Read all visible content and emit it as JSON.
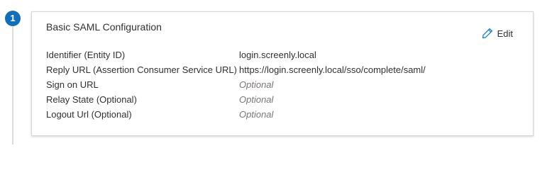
{
  "step": {
    "number": "1"
  },
  "card": {
    "title": "Basic SAML Configuration",
    "edit_label": "Edit",
    "rows": [
      {
        "label": "Identifier (Entity ID)",
        "value": "login.screenly.local",
        "optional": false
      },
      {
        "label": "Reply URL (Assertion Consumer Service URL)",
        "value": "https://login.screenly.local/sso/complete/saml/",
        "optional": false
      },
      {
        "label": "Sign on URL",
        "value": "Optional",
        "optional": true
      },
      {
        "label": "Relay State (Optional)",
        "value": "Optional",
        "optional": true
      },
      {
        "label": "Logout Url (Optional)",
        "value": "Optional",
        "optional": true
      }
    ]
  },
  "colors": {
    "step_badge": "#106ebe",
    "pencil_icon": "#0078d4"
  }
}
